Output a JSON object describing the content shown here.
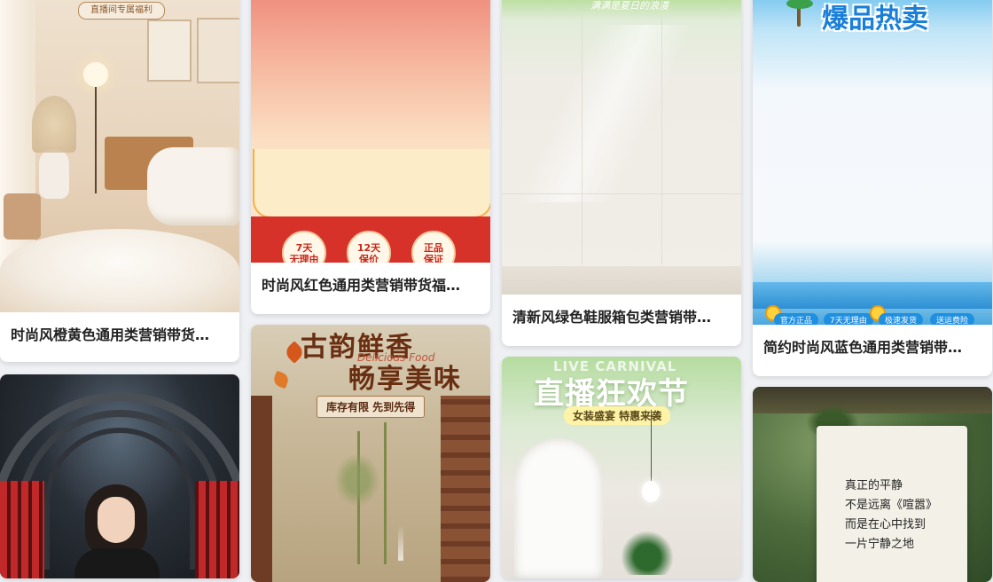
{
  "cards": [
    {
      "title": "时尚风橙黄色通用类营销带货…",
      "banner_text": "直播间专属福利"
    },
    {
      "title": "时尚风红色通用类营销带货福…",
      "badges": [
        "7天\n无理由",
        "12天\n保价",
        "正品\n保证"
      ]
    },
    {
      "title": "清新风绿色鞋服箱包类营销带…",
      "top_text": "满满是夏日的浪漫"
    },
    {
      "title": "简约时尚风蓝色通用类营销带…",
      "headline": "爆品热卖",
      "pills": [
        "官方正品",
        "7天无理由",
        "极速发货",
        "送运费险"
      ]
    },
    {
      "title": ""
    },
    {
      "title": "",
      "headline_1": "古韵鲜香",
      "headline_2": "畅享美味",
      "script_text": "Delicious Food",
      "tag": "库存有限 先到先得"
    },
    {
      "title": "",
      "en_text": "LIVE CARNIVAL",
      "headline": "直播狂欢节",
      "tag": "女装盛宴 特惠来袭"
    },
    {
      "title": "",
      "cloth_text": [
        "真正的平静",
        "不是远离《喧嚣》",
        "而是在心中找到",
        "一片宁静之地"
      ]
    }
  ]
}
